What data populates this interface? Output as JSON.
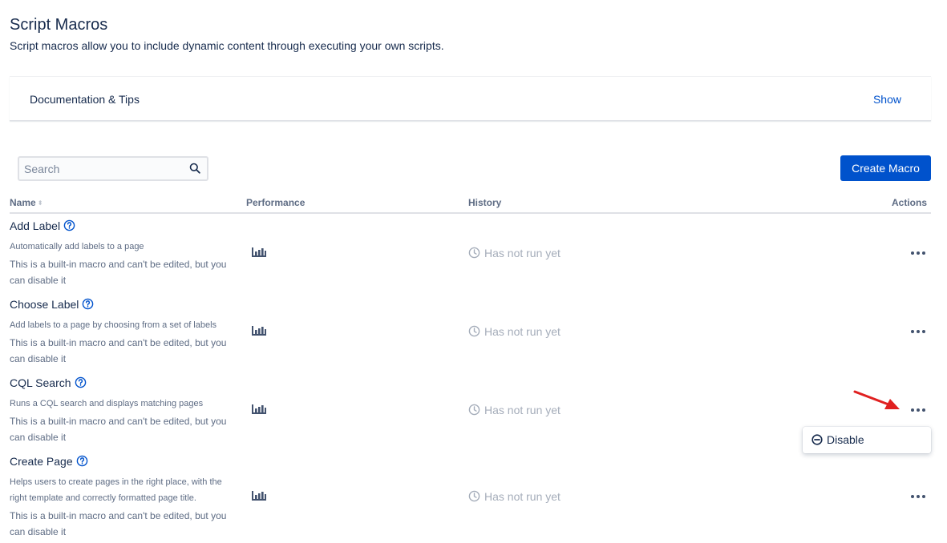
{
  "header": {
    "title": "Script Macros",
    "subtitle": "Script macros allow you to include dynamic content through executing your own scripts."
  },
  "docs": {
    "title": "Documentation & Tips",
    "toggle_label": "Show"
  },
  "search": {
    "placeholder": "Search",
    "value": ""
  },
  "toolbar": {
    "create_label": "Create Macro"
  },
  "table": {
    "columns": {
      "name": "Name",
      "performance": "Performance",
      "history": "History",
      "actions": "Actions"
    },
    "rows": [
      {
        "name": "Add Label",
        "description": "Automatically add labels to a page",
        "note": "This is a built-in macro and can't be edited, but you can disable it",
        "history": "Has not run yet"
      },
      {
        "name": "Choose Label",
        "description": "Add labels to a page by choosing from a set of labels",
        "note": "This is a built-in macro and can't be edited, but you can disable it",
        "history": "Has not run yet"
      },
      {
        "name": "CQL Search",
        "description": "Runs a CQL search and displays matching pages",
        "note": "This is a built-in macro and can't be edited, but you can disable it",
        "history": "Has not run yet"
      },
      {
        "name": "Create Page",
        "description": "Helps users to create pages in the right place, with the right template and correctly formatted page title.",
        "note": "This is a built-in macro and can't be edited, but you can disable it",
        "history": "Has not run yet"
      }
    ]
  },
  "actions_menu": {
    "disable_label": "Disable"
  },
  "icons": {
    "search": "search-icon",
    "help": "help-icon",
    "performance": "bar-chart-icon",
    "history": "clock-icon",
    "more": "more-horizontal-icon",
    "disable": "minus-circle-icon",
    "annotation": "red-arrow-icon"
  },
  "colors": {
    "primary": "#0052cc",
    "text": "#172b4d",
    "subtle": "#5e6c84",
    "muted": "#a5adba",
    "annotation": "#e02020"
  }
}
